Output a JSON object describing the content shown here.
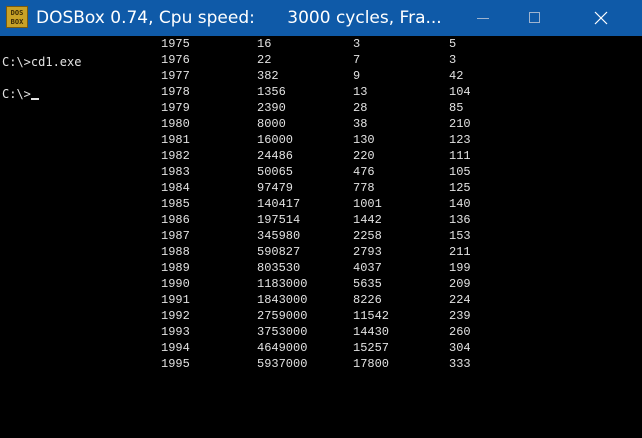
{
  "window": {
    "title": "DOSBox 0.74, Cpu speed:      3000 cycles, Fra...",
    "icon_name": "dosbox-icon",
    "icon_text": [
      "DOS",
      "BOX"
    ],
    "accent_color": "#0f5aa8"
  },
  "console": {
    "prompt_1": "C:\\>cd1.exe",
    "prompt_2": "C:\\>",
    "table": [
      [
        "1975",
        "16",
        "3",
        "5"
      ],
      [
        "1976",
        "22",
        "7",
        "3"
      ],
      [
        "1977",
        "382",
        "9",
        "42"
      ],
      [
        "1978",
        "1356",
        "13",
        "104"
      ],
      [
        "1979",
        "2390",
        "28",
        "85"
      ],
      [
        "1980",
        "8000",
        "38",
        "210"
      ],
      [
        "1981",
        "16000",
        "130",
        "123"
      ],
      [
        "1982",
        "24486",
        "220",
        "111"
      ],
      [
        "1983",
        "50065",
        "476",
        "105"
      ],
      [
        "1984",
        "97479",
        "778",
        "125"
      ],
      [
        "1985",
        "140417",
        "1001",
        "140"
      ],
      [
        "1986",
        "197514",
        "1442",
        "136"
      ],
      [
        "1987",
        "345980",
        "2258",
        "153"
      ],
      [
        "1988",
        "590827",
        "2793",
        "211"
      ],
      [
        "1989",
        "803530",
        "4037",
        "199"
      ],
      [
        "1990",
        "1183000",
        "5635",
        "209"
      ],
      [
        "1991",
        "1843000",
        "8226",
        "224"
      ],
      [
        "1992",
        "2759000",
        "11542",
        "239"
      ],
      [
        "1993",
        "3753000",
        "14430",
        "260"
      ],
      [
        "1994",
        "4649000",
        "15257",
        "304"
      ],
      [
        "1995",
        "5937000",
        "17800",
        "333"
      ]
    ]
  }
}
